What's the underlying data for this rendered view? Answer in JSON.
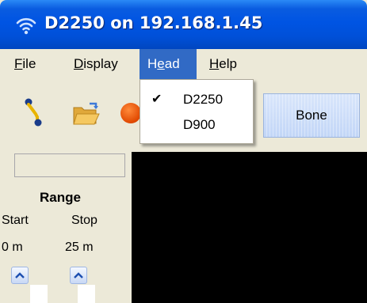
{
  "window": {
    "title": "D2250 on 192.168.1.45",
    "title_icon": "wireless-icon"
  },
  "menubar": {
    "items": [
      {
        "prefix": "",
        "accel": "F",
        "suffix": "ile",
        "active": false
      },
      {
        "prefix": "",
        "accel": "D",
        "suffix": "isplay",
        "active": false
      },
      {
        "prefix": "H",
        "accel": "e",
        "suffix": "ad",
        "active": true
      },
      {
        "prefix": "",
        "accel": "H",
        "suffix": "elp",
        "active": false
      }
    ]
  },
  "toolbar": {
    "icons": [
      "draw-line-icon",
      "open-folder-icon",
      "record-icon"
    ],
    "bone_label": "Bone"
  },
  "head_menu": {
    "items": [
      {
        "label": "D2250",
        "checked": true,
        "check_glyph": "✔"
      },
      {
        "label": "D900",
        "checked": false,
        "check_glyph": ""
      }
    ]
  },
  "range_panel": {
    "title": "Range",
    "start_label": "Start",
    "stop_label": "Stop",
    "start_value": "0 m",
    "stop_value": "25 m"
  },
  "colors": {
    "titlebar": "#0054e3",
    "menu_highlight": "#316ac5",
    "face": "#ece9d8",
    "display_bg": "#000000"
  }
}
